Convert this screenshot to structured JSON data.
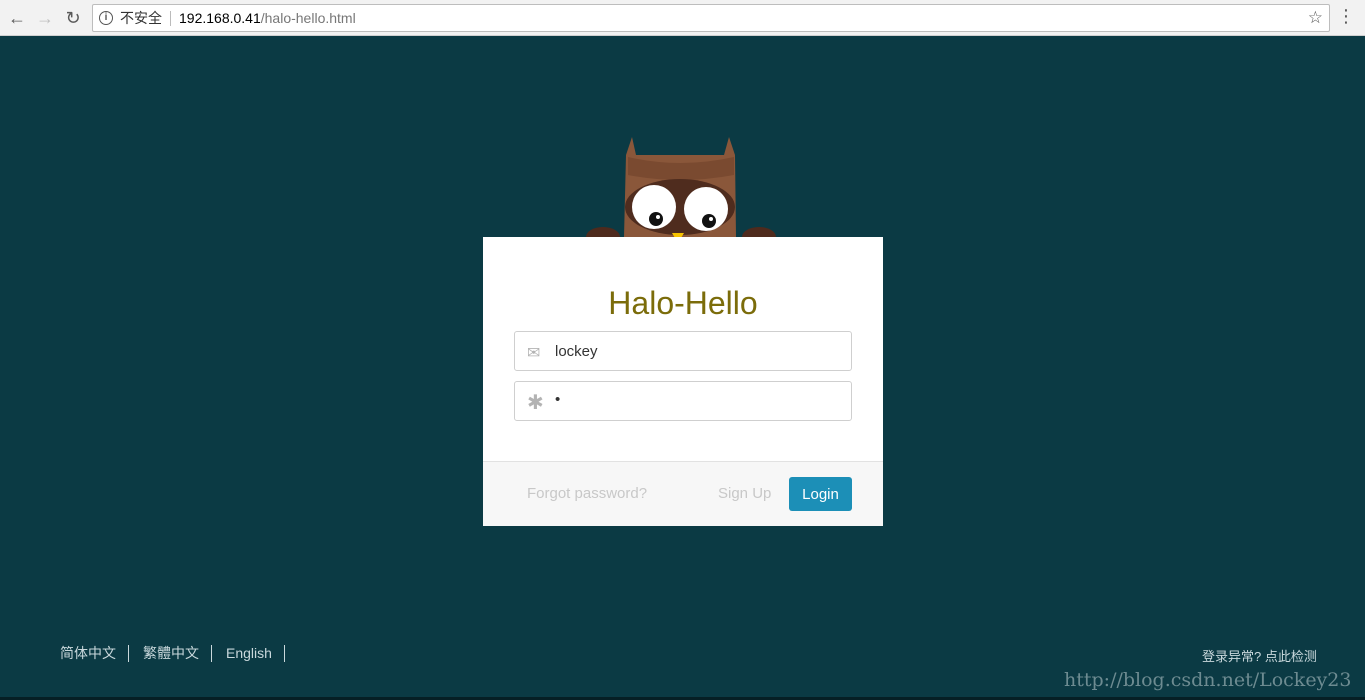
{
  "browser": {
    "security_label": "不安全",
    "url_host": "192.168.0.41",
    "url_path": "/halo-hello.html"
  },
  "login": {
    "title": "Halo-Hello",
    "username_value": "lockey",
    "password_value": "•",
    "forgot_label": "Forgot password?",
    "signup_label": "Sign Up",
    "login_label": "Login"
  },
  "footer": {
    "languages": [
      "简体中文",
      "繁體中文",
      "English"
    ],
    "check_link": "登录异常? 点此检测"
  },
  "watermark": "http://blog.csdn.net/Lockey23",
  "colors": {
    "background": "#0b3a44",
    "accent": "#1c8fb7",
    "title": "#7b6c0a"
  }
}
